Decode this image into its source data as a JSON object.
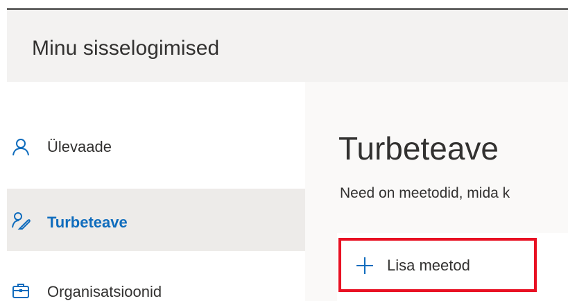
{
  "header": {
    "app_title": "Minu sisselogimised"
  },
  "sidebar": {
    "items": [
      {
        "label": "Ülevaade",
        "icon": "person-icon",
        "selected": false
      },
      {
        "label": "Turbeteave",
        "icon": "person-key-icon",
        "selected": true
      },
      {
        "label": "Organisatsioonid",
        "icon": "briefcase-icon",
        "selected": false
      }
    ]
  },
  "main": {
    "title": "Turbeteave",
    "description": "Need on meetodid, mida k",
    "add_method_label": "Lisa meetod",
    "add_method_icon": "plus-icon"
  },
  "colors": {
    "accent": "#0f6cbd",
    "highlight_border": "#e81123",
    "header_bg": "#f3f2f1",
    "selected_bg": "#edebe9"
  }
}
